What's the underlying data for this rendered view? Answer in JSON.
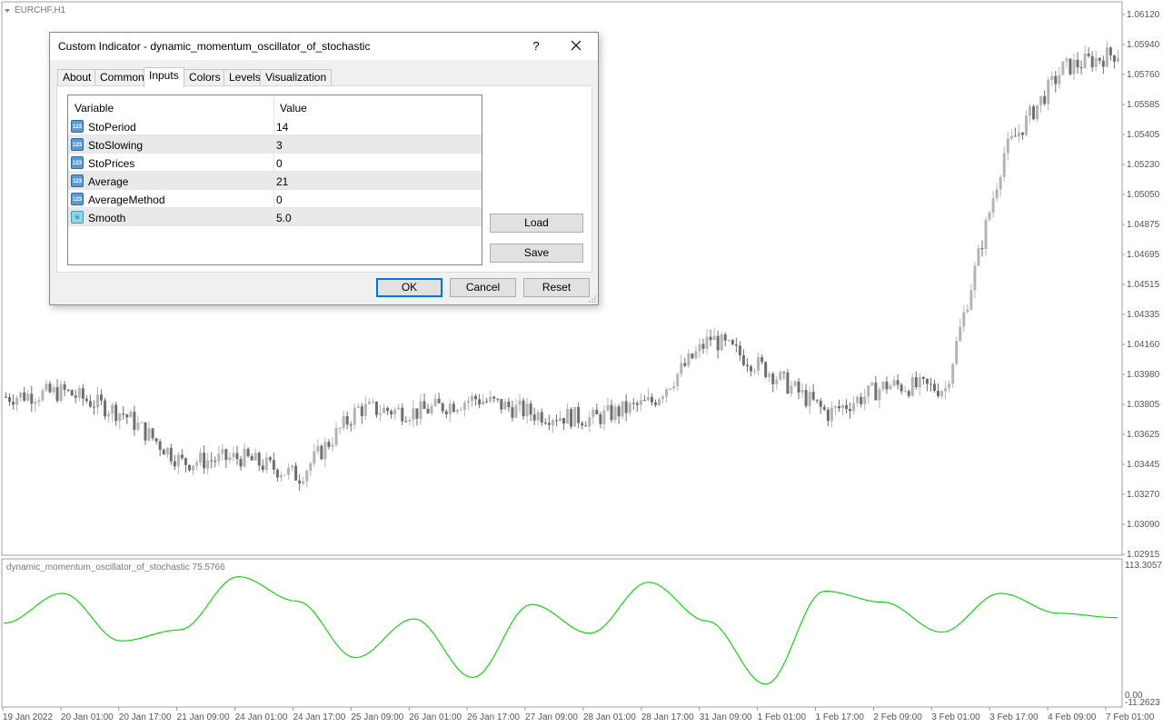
{
  "chart": {
    "symbol_label": "EURCHF,H1",
    "price_axis": [
      "1.06120",
      "1.05940",
      "1.05760",
      "1.05585",
      "1.05405",
      "1.05230",
      "1.05050",
      "1.04875",
      "1.04695",
      "1.04515",
      "1.04335",
      "1.04160",
      "1.03980",
      "1.03805",
      "1.03625",
      "1.03445",
      "1.03270",
      "1.03090",
      "1.02915"
    ],
    "time_axis": [
      "19 Jan 2022",
      "20 Jan 01:00",
      "20 Jan 17:00",
      "21 Jan 09:00",
      "24 Jan 01:00",
      "24 Jan 17:00",
      "25 Jan 09:00",
      "26 Jan 01:00",
      "26 Jan 17:00",
      "27 Jan 09:00",
      "28 Jan 01:00",
      "28 Jan 17:00",
      "31 Jan 09:00",
      "1 Feb 01:00",
      "1 Feb 17:00",
      "2 Feb 09:00",
      "3 Feb 01:00",
      "3 Feb 17:00",
      "4 Feb 09:00",
      "7 Feb 01:00"
    ],
    "indicator_label": "dynamic_momentum_oscillator_of_stochastic 75.5766",
    "indicator_axis": {
      "max": "113.3057",
      "zero": "0.00",
      "min": "-11.2623"
    },
    "colors": {
      "line": "#00d600",
      "candle": "#b4b4b4",
      "candle_dark": "#6e6e6e"
    }
  },
  "chart_data": [
    {
      "type": "candlestick",
      "title": "EURCHF,H1",
      "x": [
        "19 Jan 2022",
        "20 Jan 01:00",
        "20 Jan 17:00",
        "21 Jan 09:00",
        "24 Jan 01:00",
        "24 Jan 17:00",
        "25 Jan 09:00",
        "26 Jan 01:00",
        "26 Jan 17:00",
        "27 Jan 09:00",
        "28 Jan 01:00",
        "28 Jan 17:00",
        "31 Jan 09:00",
        "1 Feb 01:00",
        "1 Feb 17:00",
        "2 Feb 09:00",
        "3 Feb 01:00",
        "3 Feb 17:00",
        "4 Feb 09:00",
        "7 Feb 01:00"
      ],
      "close": [
        1.0385,
        1.0388,
        1.0375,
        1.0346,
        1.0349,
        1.0338,
        1.0378,
        1.0376,
        1.0384,
        1.0375,
        1.0372,
        1.0382,
        1.042,
        1.04,
        1.0375,
        1.0392,
        1.039,
        1.053,
        1.058,
        1.059
      ],
      "ylim": [
        1.02915,
        1.0612
      ]
    },
    {
      "type": "line",
      "title": "dynamic_momentum_oscillator_of_stochastic 75.5766",
      "x": [
        "19 Jan 2022",
        "20 Jan 01:00",
        "20 Jan 17:00",
        "21 Jan 09:00",
        "24 Jan 01:00",
        "24 Jan 17:00",
        "25 Jan 09:00",
        "26 Jan 01:00",
        "26 Jan 17:00",
        "27 Jan 09:00",
        "28 Jan 01:00",
        "28 Jan 17:00",
        "31 Jan 09:00",
        "1 Feb 01:00",
        "1 Feb 17:00",
        "2 Feb 09:00",
        "3 Feb 01:00",
        "3 Feb 17:00",
        "4 Feb 09:00",
        "7 Feb 01:00"
      ],
      "values": [
        61,
        88,
        45,
        55,
        103,
        81,
        30,
        65,
        12,
        78,
        52,
        98,
        63,
        6,
        90,
        80,
        53,
        88,
        70,
        66
      ],
      "ylim": [
        -11.2623,
        113.3057
      ]
    }
  ],
  "dialog": {
    "title": "Custom Indicator - dynamic_momentum_oscillator_of_stochastic",
    "help_label": "?",
    "tabs": [
      {
        "label": "About"
      },
      {
        "label": "Common"
      },
      {
        "label": "Inputs"
      },
      {
        "label": "Colors"
      },
      {
        "label": "Levels"
      },
      {
        "label": "Visualization"
      }
    ],
    "active_tab": "Inputs",
    "grid": {
      "header_variable": "Variable",
      "header_value": "Value",
      "rows": [
        {
          "icon": "int-param-icon",
          "icon_text": "123",
          "name": "StoPeriod",
          "value": "14"
        },
        {
          "icon": "int-param-icon",
          "icon_text": "123",
          "name": "StoSlowing",
          "value": "3"
        },
        {
          "icon": "int-param-icon",
          "icon_text": "123",
          "name": "StoPrices",
          "value": "0"
        },
        {
          "icon": "int-param-icon",
          "icon_text": "123",
          "name": "Average",
          "value": "21"
        },
        {
          "icon": "int-param-icon",
          "icon_text": "123",
          "name": "AverageMethod",
          "value": "0"
        },
        {
          "icon": "double-param-icon",
          "icon_text": "½",
          "name": "Smooth",
          "value": "5.0"
        }
      ]
    },
    "buttons": {
      "load": "Load",
      "save": "Save",
      "ok": "OK",
      "cancel": "Cancel",
      "reset": "Reset"
    }
  }
}
